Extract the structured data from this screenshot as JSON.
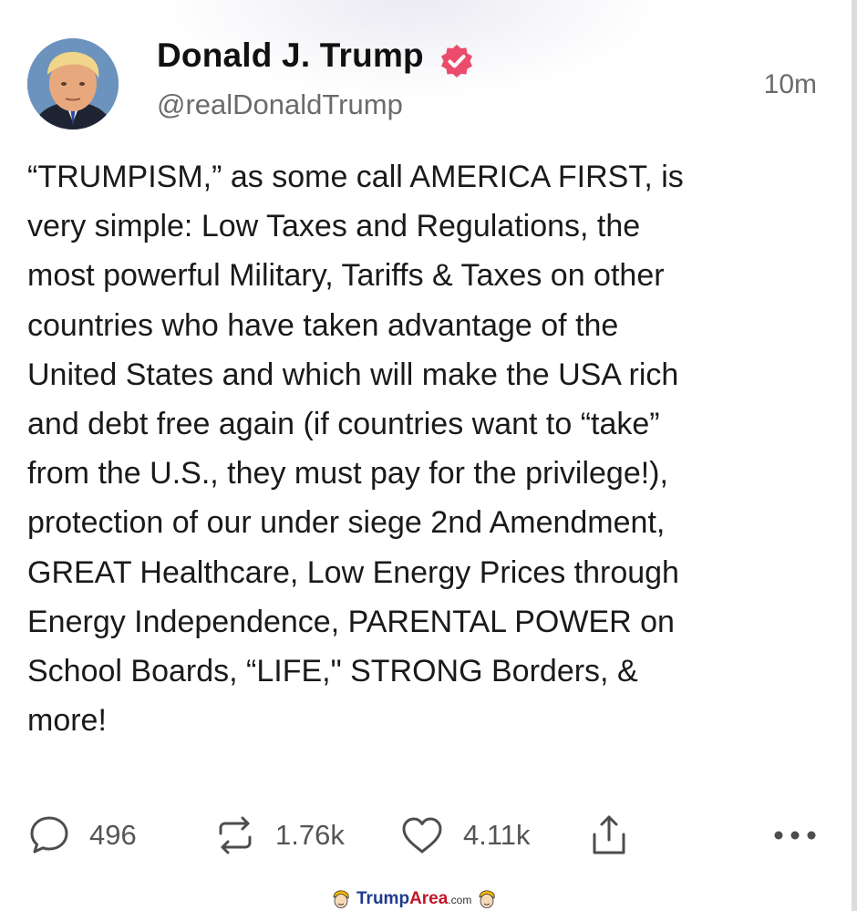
{
  "author": {
    "name": "Donald J. Trump",
    "handle": "@realDonaldTrump",
    "verified": true,
    "avatar_icon": "avatar-portrait",
    "verified_icon": "verified-badge-icon",
    "verified_color": "#ec4c6c"
  },
  "post": {
    "timestamp": "10m",
    "lines": [
      "“TRUMPISM,” as some call AMERICA FIRST, is",
      "very simple: Low Taxes and Regulations, the",
      "most powerful Military, Tariffs & Taxes on other",
      "countries who have taken advantage of the",
      "United States and which will make the USA rich",
      "and debt free again (if countries want to “take”",
      "from the U.S., they must pay for the privilege!),",
      "protection of our under siege 2nd Amendment,",
      "GREAT Healthcare, Low Energy Prices through",
      "Energy Independence, PARENTAL POWER on",
      "School Boards, “LIFE,\" STRONG Borders, &",
      "more!"
    ]
  },
  "actions": {
    "reply": {
      "icon": "comment-icon",
      "count": "496"
    },
    "repost": {
      "icon": "repost-icon",
      "count": "1.76k"
    },
    "like": {
      "icon": "heart-icon",
      "count": "4.11k"
    },
    "share": {
      "icon": "share-icon"
    },
    "more": {
      "icon": "more-icon"
    }
  },
  "watermark": {
    "part1": "Trump",
    "part2": "Area",
    "part3": ".com",
    "color_trump": "#1e3a8a",
    "color_area": "#c0162b"
  }
}
